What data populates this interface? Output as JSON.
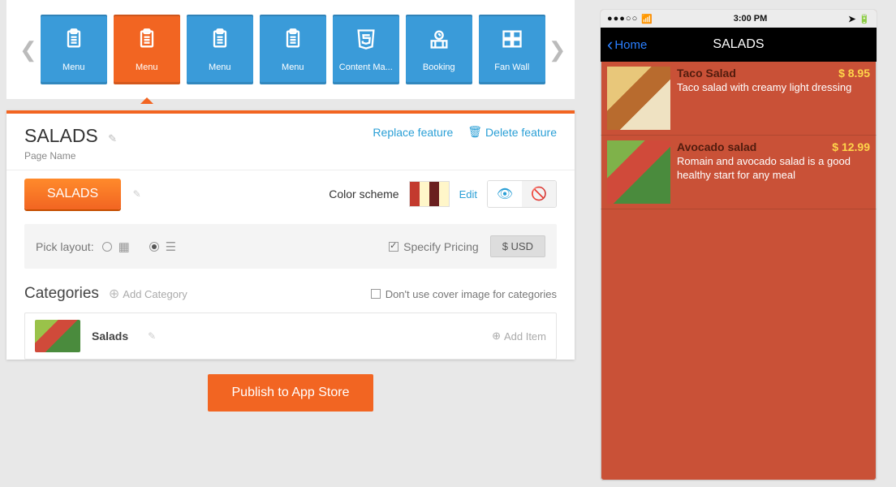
{
  "feature_tiles": [
    {
      "label": "Menu",
      "icon": "clipboard",
      "active": false
    },
    {
      "label": "Menu",
      "icon": "clipboard",
      "active": true
    },
    {
      "label": "Menu",
      "icon": "clipboard",
      "active": false
    },
    {
      "label": "Menu",
      "icon": "clipboard",
      "active": false
    },
    {
      "label": "Content Ma...",
      "icon": "html5",
      "active": false
    },
    {
      "label": "Booking",
      "icon": "booking",
      "active": false
    },
    {
      "label": "Fan Wall",
      "icon": "fanwall",
      "active": false
    }
  ],
  "editor": {
    "page_title": "SALADS",
    "page_sub": "Page Name",
    "replace_label": "Replace feature",
    "delete_label": "Delete feature",
    "button_text": "SALADS",
    "color_scheme_label": "Color scheme",
    "edit_label": "Edit",
    "swatches": [
      "#c33a2e",
      "#fff6c9",
      "#6a1f1f",
      "#fff6c9"
    ],
    "pick_layout_label": "Pick layout:",
    "layout_selected": "list",
    "specify_pricing_label": "Specify Pricing",
    "specify_pricing_checked": true,
    "currency_label": "$ USD",
    "categories_title": "Categories",
    "add_category_label": "Add Category",
    "cover_image_label": "Don't use cover image for categories",
    "cover_image_checked": false,
    "category": {
      "name": "Salads",
      "add_item_label": "Add Item"
    }
  },
  "publish_label": "Publish to App Store",
  "phone": {
    "time": "3:00 PM",
    "back_label": "Home",
    "nav_title": "SALADS",
    "items": [
      {
        "name": "Taco Salad",
        "price": "$ 8.95",
        "desc": "Taco salad with creamy light dressing",
        "thumb": "taco"
      },
      {
        "name": "Avocado salad",
        "price": "$ 12.99",
        "desc": "Romain and avocado salad is a good healthy start for any meal",
        "thumb": "avocado"
      }
    ]
  }
}
